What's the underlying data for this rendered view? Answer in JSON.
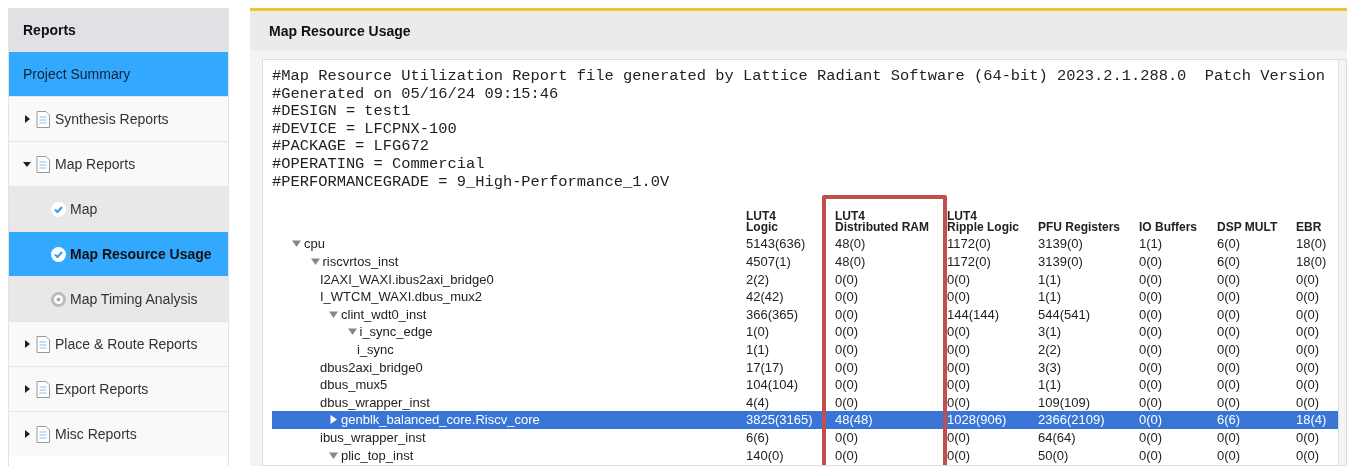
{
  "sidebar": {
    "title": "Reports",
    "items": [
      {
        "kind": "summary",
        "label": "Project Summary",
        "selected": false
      },
      {
        "kind": "group",
        "label": "Synthesis Reports",
        "expanded": false,
        "selected": false
      },
      {
        "kind": "group",
        "label": "Map Reports",
        "expanded": true,
        "selected": false
      },
      {
        "kind": "report",
        "label": "Map",
        "done": true,
        "selected": false
      },
      {
        "kind": "report",
        "label": "Map Resource Usage",
        "done": true,
        "selected": true
      },
      {
        "kind": "report",
        "label": "Map Timing Analysis",
        "done": false,
        "selected": false
      },
      {
        "kind": "group",
        "label": "Place & Route Reports",
        "expanded": false,
        "selected": false
      },
      {
        "kind": "group",
        "label": "Export Reports",
        "expanded": false,
        "selected": false
      },
      {
        "kind": "group",
        "label": "Misc Reports",
        "expanded": false,
        "selected": false
      }
    ]
  },
  "panel": {
    "title": "Map Resource Usage",
    "report_lines": [
      "#Map Resource Utilization Report file generated by Lattice Radiant Software (64-bit) 2023.2.1.288.0  Patch Version",
      "#Generated on 05/16/24 09:15:46",
      "#DESIGN = test1",
      "#DEVICE = LFCPNX-100",
      "#PACKAGE = LFG672",
      "#OPERATING = Commercial",
      "#PERFORMANCEGRADE = 9_High-Performance_1.0V"
    ],
    "table": {
      "columns": [
        {
          "label": "LUT4\nLogic",
          "highlighted": false
        },
        {
          "label": "LUT4\nDistributed RAM",
          "highlighted": true
        },
        {
          "label": "LUT4\nRipple Logic",
          "highlighted": false
        },
        {
          "label": "PFU Registers",
          "highlighted": false
        },
        {
          "label": "IO Buffers",
          "highlighted": false
        },
        {
          "label": "DSP MULT",
          "highlighted": false
        },
        {
          "label": "EBR",
          "highlighted": false
        }
      ],
      "rows": [
        {
          "name": "cpu",
          "expanded": true,
          "selected": false,
          "values": [
            "5143(636)",
            "48(0)",
            "1172(0)",
            "3139(0)",
            "1(1)",
            "6(0)",
            "18(0)"
          ],
          "children": [
            {
              "name": "riscvrtos_inst",
              "expanded": true,
              "selected": false,
              "values": [
                "4507(1)",
                "48(0)",
                "1172(0)",
                "3139(0)",
                "0(0)",
                "6(0)",
                "18(0)"
              ],
              "children": [
                {
                  "name": "I2AXI_WAXI.ibus2axi_bridge0",
                  "selected": false,
                  "values": [
                    "2(2)",
                    "0(0)",
                    "0(0)",
                    "1(1)",
                    "0(0)",
                    "0(0)",
                    "0(0)"
                  ]
                },
                {
                  "name": "I_WTCM_WAXI.dbus_mux2",
                  "selected": false,
                  "values": [
                    "42(42)",
                    "0(0)",
                    "0(0)",
                    "1(1)",
                    "0(0)",
                    "0(0)",
                    "0(0)"
                  ]
                },
                {
                  "name": "clint_wdt0_inst",
                  "expanded": true,
                  "selected": false,
                  "values": [
                    "366(365)",
                    "0(0)",
                    "144(144)",
                    "544(541)",
                    "0(0)",
                    "0(0)",
                    "0(0)"
                  ],
                  "children": [
                    {
                      "name": "i_sync_edge",
                      "expanded": true,
                      "selected": false,
                      "values": [
                        "1(0)",
                        "0(0)",
                        "0(0)",
                        "3(1)",
                        "0(0)",
                        "0(0)",
                        "0(0)"
                      ],
                      "children": [
                        {
                          "name": "i_sync",
                          "selected": false,
                          "values": [
                            "1(1)",
                            "0(0)",
                            "0(0)",
                            "2(2)",
                            "0(0)",
                            "0(0)",
                            "0(0)"
                          ]
                        }
                      ]
                    }
                  ]
                },
                {
                  "name": "dbus2axi_bridge0",
                  "selected": false,
                  "values": [
                    "17(17)",
                    "0(0)",
                    "0(0)",
                    "3(3)",
                    "0(0)",
                    "0(0)",
                    "0(0)"
                  ]
                },
                {
                  "name": "dbus_mux5",
                  "selected": false,
                  "values": [
                    "104(104)",
                    "0(0)",
                    "0(0)",
                    "1(1)",
                    "0(0)",
                    "0(0)",
                    "0(0)"
                  ]
                },
                {
                  "name": "dbus_wrapper_inst",
                  "selected": false,
                  "values": [
                    "4(4)",
                    "0(0)",
                    "0(0)",
                    "109(109)",
                    "0(0)",
                    "0(0)",
                    "0(0)"
                  ]
                },
                {
                  "name": "genblk_balanced_core.Riscv_core",
                  "expanded": false,
                  "selected": true,
                  "values": [
                    "3825(3165)",
                    "48(48)",
                    "1028(906)",
                    "2366(2109)",
                    "0(0)",
                    "6(6)",
                    "18(4)"
                  ]
                },
                {
                  "name": "ibus_wrapper_inst",
                  "selected": false,
                  "values": [
                    "6(6)",
                    "0(0)",
                    "0(0)",
                    "64(64)",
                    "0(0)",
                    "0(0)",
                    "0(0)"
                  ]
                },
                {
                  "name": "plic_top_inst",
                  "expanded": true,
                  "selected": false,
                  "values": [
                    "140(0)",
                    "0(0)",
                    "0(0)",
                    "50(0)",
                    "0(0)",
                    "0(0)",
                    "0(0)"
                  ]
                }
              ]
            }
          ]
        }
      ]
    }
  }
}
